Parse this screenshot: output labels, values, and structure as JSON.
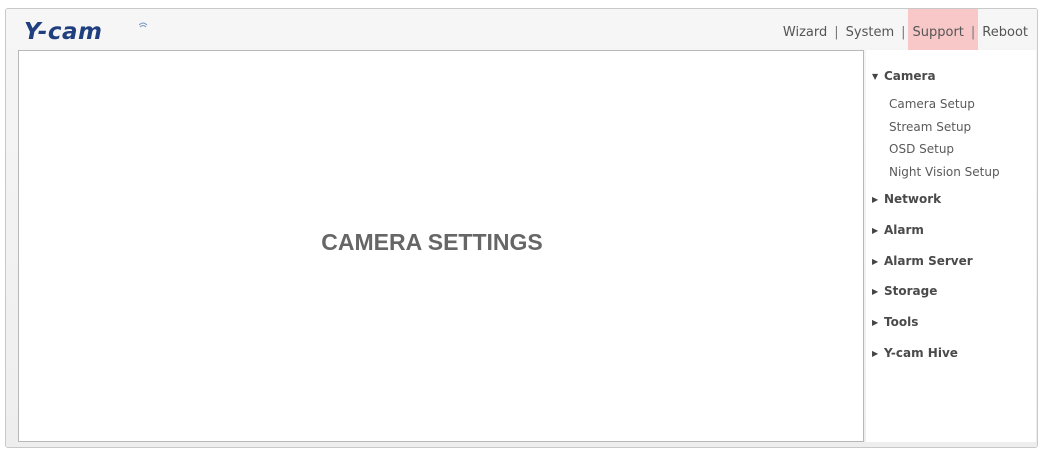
{
  "header": {
    "logo_text": "Y-cam",
    "nav": [
      {
        "label": "Wizard"
      },
      {
        "label": "System"
      },
      {
        "label": "Support"
      },
      {
        "label": "Reboot"
      }
    ],
    "separator": "|",
    "highlight_color": "#f8b8b8"
  },
  "main": {
    "title": "CAMERA SETTINGS"
  },
  "sidebar": {
    "expanded_arrow": "▼",
    "collapsed_arrow": "▶",
    "camera": {
      "label": "Camera",
      "items": [
        {
          "label": "Camera Setup"
        },
        {
          "label": "Stream Setup"
        },
        {
          "label": "OSD Setup"
        },
        {
          "label": "Night Vision Setup"
        }
      ]
    },
    "categories": [
      {
        "label": "Network"
      },
      {
        "label": "Alarm"
      },
      {
        "label": "Alarm Server"
      },
      {
        "label": "Storage"
      },
      {
        "label": "Tools"
      },
      {
        "label": "Y-cam Hive"
      }
    ]
  },
  "colors": {
    "logo": "#1f3f7f",
    "text": "#555555"
  }
}
